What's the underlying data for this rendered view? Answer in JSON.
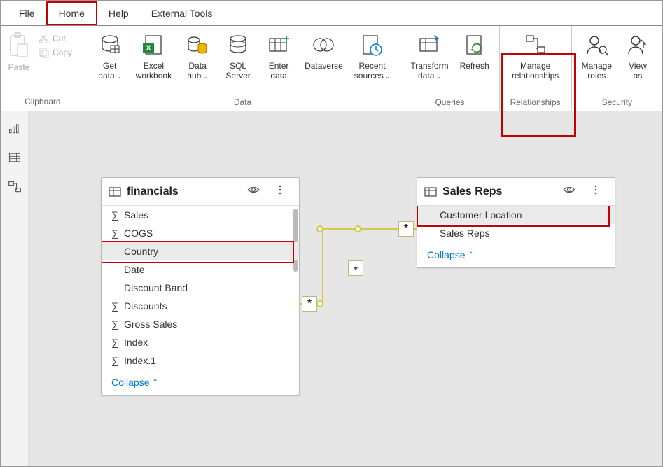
{
  "menubar": {
    "items": [
      "File",
      "Home",
      "Help",
      "External Tools"
    ],
    "selected": 1
  },
  "ribbon": {
    "clipboard": {
      "paste": "Paste",
      "cut": "Cut",
      "copy": "Copy",
      "group_label": "Clipboard"
    },
    "data": {
      "get_data": "Get\ndata",
      "excel": "Excel\nworkbook",
      "data_hub": "Data\nhub",
      "sql": "SQL\nServer",
      "enter": "Enter\ndata",
      "dataverse": "Dataverse",
      "recent": "Recent\nsources",
      "group_label": "Data"
    },
    "queries": {
      "transform": "Transform\ndata",
      "refresh": "Refresh",
      "group_label": "Queries"
    },
    "relationships": {
      "manage": "Manage\nrelationships",
      "group_label": "Relationships"
    },
    "security": {
      "manage_roles": "Manage\nroles",
      "view_as": "View\nas",
      "group_label": "Security"
    }
  },
  "tables": {
    "financials": {
      "name": "financials",
      "fields": [
        {
          "name": "Sales",
          "agg": true
        },
        {
          "name": "COGS",
          "agg": true
        },
        {
          "name": "Country",
          "agg": false,
          "highlighted": true
        },
        {
          "name": "Date",
          "agg": false
        },
        {
          "name": "Discount Band",
          "agg": false
        },
        {
          "name": "Discounts",
          "agg": true
        },
        {
          "name": "Gross Sales",
          "agg": true
        },
        {
          "name": "Index",
          "agg": true
        },
        {
          "name": "Index.1",
          "agg": true
        }
      ],
      "collapse": "Collapse"
    },
    "sales_reps": {
      "name": "Sales Reps",
      "fields": [
        {
          "name": "Customer Location",
          "agg": false,
          "highlighted": true
        },
        {
          "name": "Sales Reps",
          "agg": false
        }
      ],
      "collapse": "Collapse"
    }
  },
  "relationship": {
    "left_card": "*",
    "right_card": "*"
  }
}
